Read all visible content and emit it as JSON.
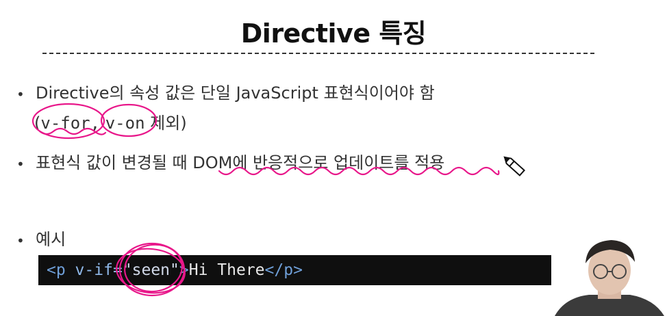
{
  "slide": {
    "title": "Directive 특징",
    "bullets": [
      {
        "line1": "Directive의 속성 값은 단일 JavaScript 표현식이어야 함",
        "open_paren": "(",
        "code1": "v-for,",
        "code2": "v-on",
        "suffix": "제외)"
      },
      {
        "text": "표현식 값이 변경될 때 DOM에 반응적으로 업데이트를 적용"
      },
      {
        "text": "예시"
      }
    ],
    "code_example": {
      "open_tag": "<p",
      "attr": " v-if=",
      "value": "\"seen\"",
      "close_bracket": ">",
      "content": "Hi There",
      "end_tag": "</p>"
    }
  },
  "colors": {
    "annotation_pink": "#e8178a",
    "code_background": "#0f0f0f"
  },
  "icons": [
    "pencil-cursor-icon"
  ]
}
